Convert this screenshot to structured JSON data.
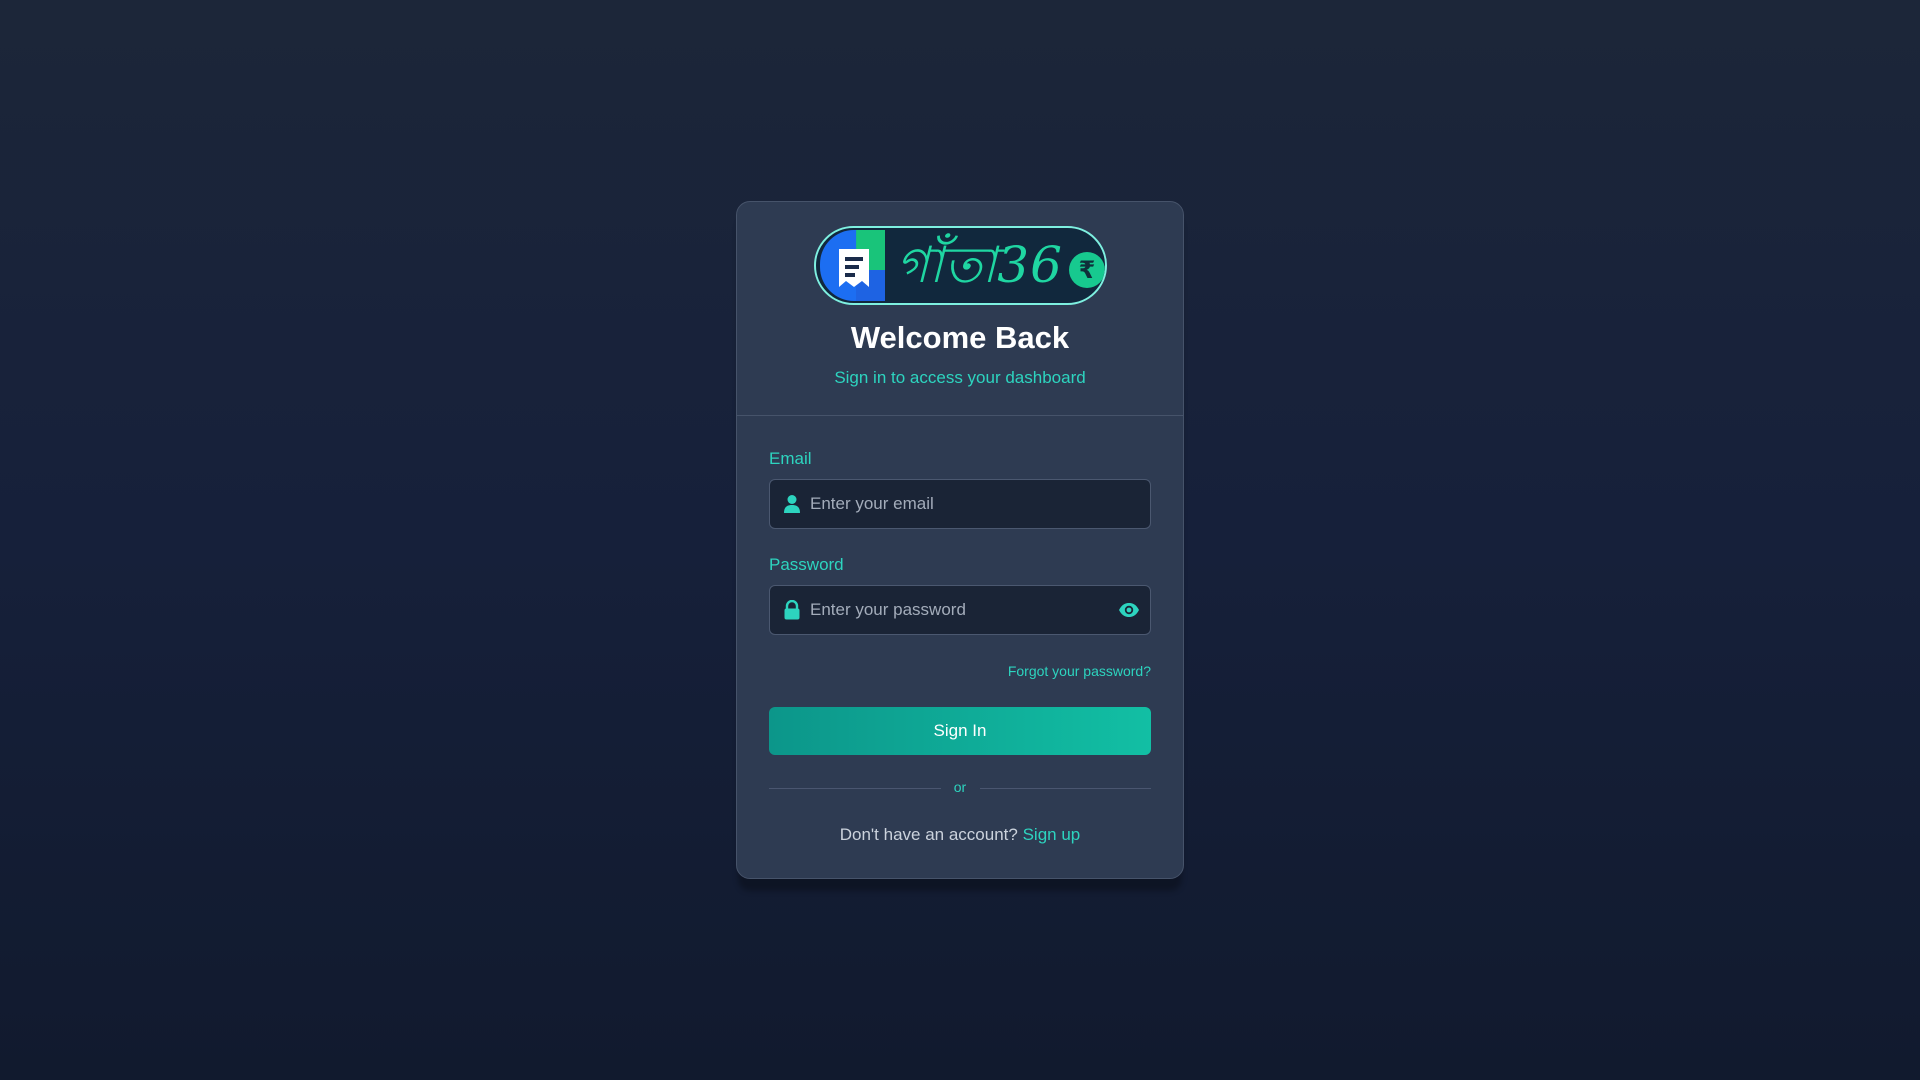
{
  "brand": {
    "logo_text": "গাঁতা36",
    "currency_symbol": "₹",
    "colors": {
      "accent": "#2dd4bf",
      "logo_green": "#1fd6a2",
      "logo_blue": "#1c6ef2"
    }
  },
  "header": {
    "title": "Welcome Back",
    "subtitle": "Sign in to access your dashboard"
  },
  "form": {
    "email": {
      "label": "Email",
      "placeholder": "Enter your email",
      "value": "",
      "icon": "user-icon"
    },
    "password": {
      "label": "Password",
      "placeholder": "Enter your password",
      "value": "",
      "icon": "lock-icon",
      "toggle_icon": "eye-icon"
    },
    "forgot_label": "Forgot your password?",
    "submit_label": "Sign In",
    "divider_label": "or"
  },
  "footer": {
    "prompt": "Don't have an account? ",
    "signup_label": "Sign up"
  },
  "theme": {
    "background": "#16203a",
    "card": "#2e3b52",
    "button_start": "#0c968a",
    "button_end": "#12bfa4"
  }
}
